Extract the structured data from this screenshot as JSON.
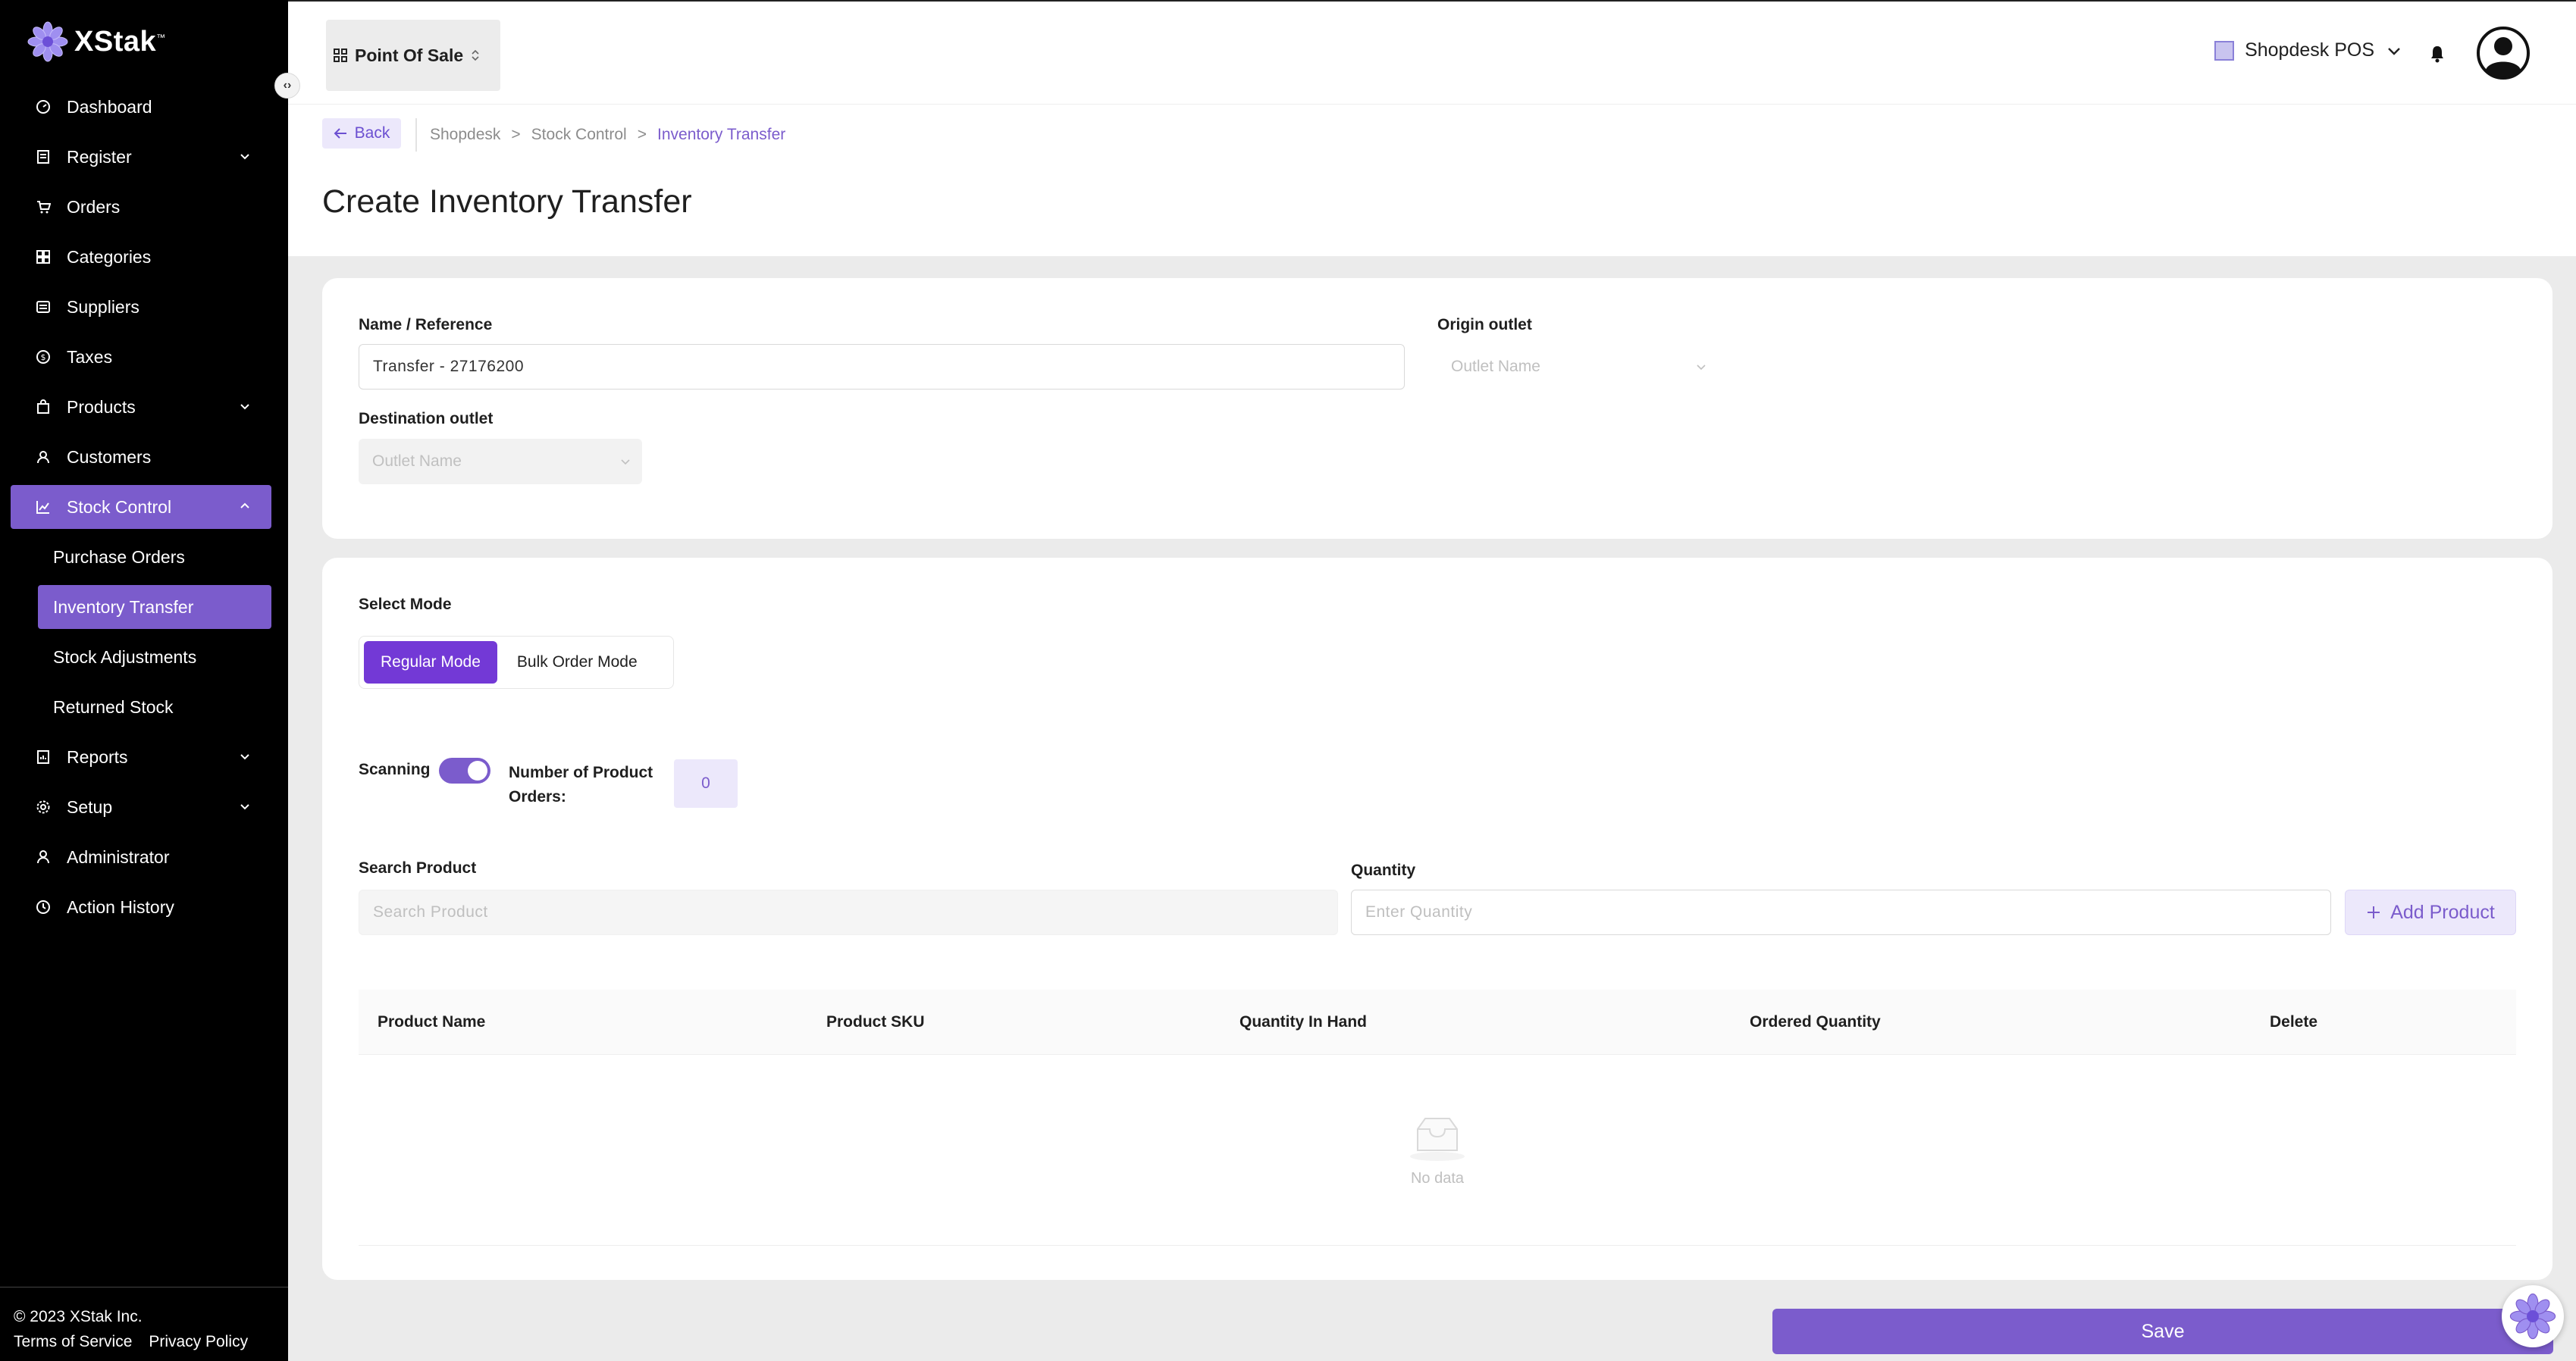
{
  "brand": {
    "name": "XStak",
    "mark": "™"
  },
  "sidebar": {
    "items": [
      {
        "label": "Dashboard",
        "icon": "dashboard-icon"
      },
      {
        "label": "Register",
        "icon": "register-icon",
        "expandable": true
      },
      {
        "label": "Orders",
        "icon": "cart-icon"
      },
      {
        "label": "Categories",
        "icon": "grid-icon"
      },
      {
        "label": "Suppliers",
        "icon": "supplier-icon"
      },
      {
        "label": "Taxes",
        "icon": "tax-icon"
      },
      {
        "label": "Products",
        "icon": "bag-icon",
        "expandable": true
      },
      {
        "label": "Customers",
        "icon": "user-icon"
      },
      {
        "label": "Stock Control",
        "icon": "chart-icon",
        "expandable": true,
        "active": true
      },
      {
        "label": "Reports",
        "icon": "report-icon",
        "expandable": true
      },
      {
        "label": "Setup",
        "icon": "gear-icon",
        "expandable": true
      },
      {
        "label": "Administrator",
        "icon": "admin-icon"
      },
      {
        "label": "Action History",
        "icon": "history-icon"
      }
    ],
    "subitems": [
      {
        "label": "Purchase Orders"
      },
      {
        "label": "Inventory Transfer",
        "active": true
      },
      {
        "label": "Stock Adjustments"
      },
      {
        "label": "Returned Stock"
      }
    ],
    "footer": {
      "copyright": "© 2023 XStak Inc.",
      "terms": "Terms of Service",
      "privacy": "Privacy Policy"
    }
  },
  "header": {
    "app_switch": "Point Of Sale",
    "store": "Shopdesk POS"
  },
  "breadcrumb": {
    "back": "Back",
    "items": [
      "Shopdesk",
      ">",
      "Stock Control",
      ">",
      "Inventory Transfer"
    ]
  },
  "page_title": "Create Inventory Transfer",
  "form": {
    "name_label": "Name / Reference",
    "name_value": "Transfer - 27176200",
    "origin_label": "Origin outlet",
    "origin_placeholder": "Outlet Name",
    "dest_label": "Destination outlet",
    "dest_placeholder": "Outlet Name"
  },
  "mode": {
    "label": "Select Mode",
    "regular": "Regular Mode",
    "bulk": "Bulk Order Mode",
    "selected": "Regular Mode"
  },
  "scanning": {
    "label": "Scanning",
    "enabled": true,
    "count_label_1": "Number of Product",
    "count_label_2": "Orders:",
    "count": "0"
  },
  "search": {
    "label": "Search Product",
    "placeholder": "Search Product",
    "qty_label": "Quantity",
    "qty_placeholder": "Enter Quantity",
    "add_button": "Add Product"
  },
  "table": {
    "columns": [
      "Product Name",
      "Product SKU",
      "Quantity In Hand",
      "Ordered Quantity",
      "Delete"
    ],
    "empty_text": "No data"
  },
  "save_label": "Save",
  "colors": {
    "accent": "#7b5ccc",
    "accent_dark": "#7339d6",
    "accent_light": "#ece8fb"
  }
}
